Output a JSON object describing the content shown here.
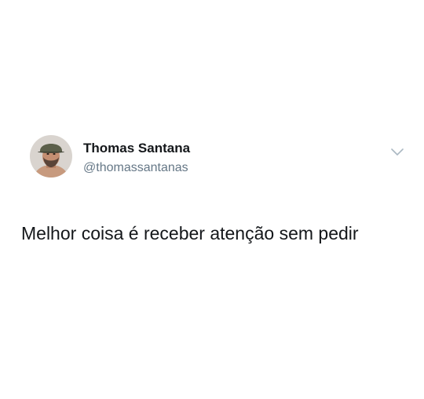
{
  "tweet": {
    "author": {
      "display_name": "Thomas Santana",
      "handle": "@thomassantanas",
      "avatar_icon": "user-avatar-photo"
    },
    "menu_icon": "chevron-down-icon",
    "text": "Melhor coisa é receber atenção sem pedir"
  },
  "colors": {
    "name": "#14171a",
    "handle": "#657786",
    "chevron": "#aab8c2",
    "background": "#ffffff"
  }
}
